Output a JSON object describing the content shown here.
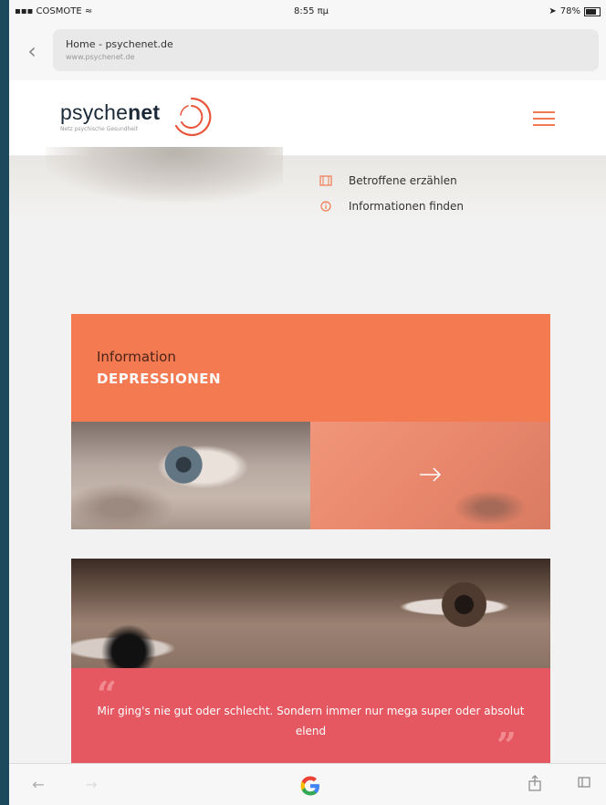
{
  "status_bar": {
    "carrier": "COSMOTE",
    "time": "8:55 πμ",
    "battery": "78%"
  },
  "browser": {
    "page_title": "Home - psychenet.de",
    "page_url": "www.psychenet.de"
  },
  "site": {
    "logo_prefix": "psyche",
    "logo_suffix": "net",
    "logo_tagline": "Netz psychische Gesundheit",
    "accent_color": "#f07b52"
  },
  "hero": {
    "items": [
      {
        "label": "Betroffene erzählen",
        "icon": "film-icon"
      },
      {
        "label": "Informationen finden",
        "icon": "info-icon"
      }
    ]
  },
  "info_card": {
    "eyebrow": "Information",
    "headline": "DEPRESSIONEN",
    "color": "#f47a51"
  },
  "quote_card": {
    "text": "Mir ging's nie gut oder schlecht. Sondern immer nur mega super oder absolut elend",
    "color": "#e55862"
  },
  "toolbar": {
    "icons": [
      "back-icon",
      "forward-icon",
      "google-icon",
      "share-icon",
      "tabs-icon"
    ]
  }
}
